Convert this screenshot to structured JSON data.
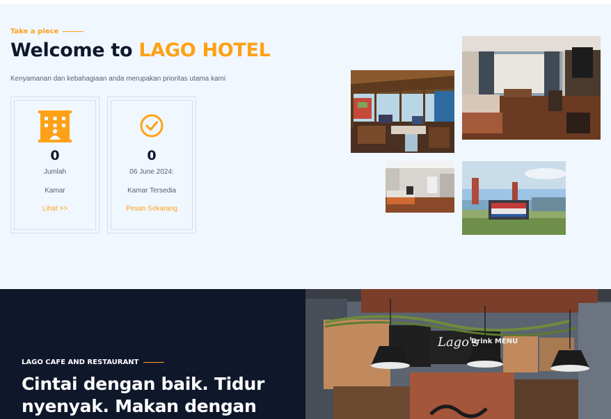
{
  "about": {
    "eyebrow": "Take a piece",
    "title_prefix": "Welcome to",
    "title_brand": "LAGO HOTEL",
    "lead": "Kenyamanan dan kebahagiaan anda merupakan prioritas utama kami",
    "stats": [
      {
        "icon": "hotel-building-icon",
        "value": "0",
        "label1": "Jumlah",
        "label2": "Kamar",
        "link": "Lihat >>"
      },
      {
        "icon": "check-circle-icon",
        "value": "0",
        "label1": "06 June 2024:",
        "label2": "Kamar Tersedia",
        "link": "Pesan Sekarang"
      }
    ]
  },
  "gallery": [
    {
      "name": "restaurant-terrace-photo"
    },
    {
      "name": "hotel-room-photo"
    },
    {
      "name": "room-interior-photo"
    },
    {
      "name": "beach-monument-photo"
    }
  ],
  "restaurant": {
    "eyebrow": "LAGO CAFE AND RESTAURANT",
    "title": "Cintai dengan baik. Tidur nyenyak. Makan dengan",
    "sign_text": "Lago's",
    "menu_text": "Drink MENU"
  },
  "colors": {
    "accent": "#fea116",
    "dark": "#0f172b",
    "section_bg": "#f1f7ff"
  }
}
